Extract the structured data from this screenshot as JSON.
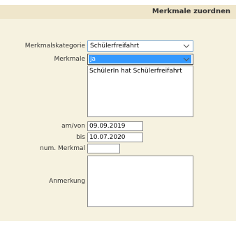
{
  "header": {
    "title": "Merkmale zuordnen"
  },
  "form": {
    "kategorie_label": "Merkmalskategorie",
    "kategorie_value": "Schülerfreifahrt",
    "merkmale_label": "Merkmale",
    "merkmale_value": "ja",
    "merkmale_list": [
      "SchülerIn hat Schülerfreifahrt"
    ],
    "von_label": "am/von",
    "von_value": "09.09.2019",
    "bis_label": "bis",
    "bis_value": "10.07.2020",
    "num_label": "num. Merkmal",
    "num_value": "",
    "anmerkung_label": "Anmerkung",
    "anmerkung_value": ""
  },
  "icons": {
    "dropdown": "chevron-down-icon"
  },
  "colors": {
    "panel": "#f6f2e0",
    "header": "#efe6cb",
    "selected": "#3399ff"
  }
}
